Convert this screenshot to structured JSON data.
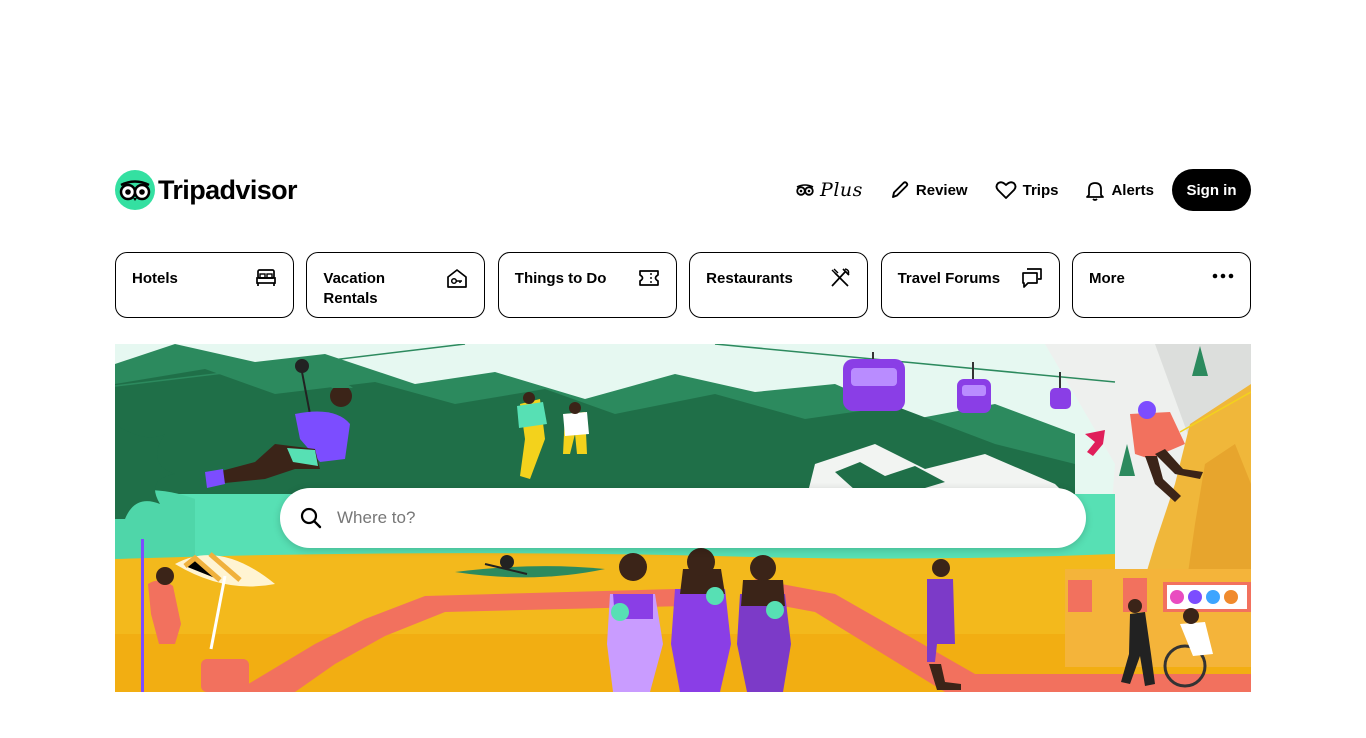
{
  "brand": {
    "name": "Tripadvisor",
    "logo_color": "#34e0a1"
  },
  "header": {
    "plus_label": "Plus",
    "review_label": "Review",
    "trips_label": "Trips",
    "alerts_label": "Alerts",
    "signin_label": "Sign in"
  },
  "categories": [
    {
      "label": "Hotels",
      "icon": "bed-icon"
    },
    {
      "label": "Vacation Rentals",
      "icon": "house-key-icon"
    },
    {
      "label": "Things to Do",
      "icon": "ticket-icon"
    },
    {
      "label": "Restaurants",
      "icon": "fork-knife-icon"
    },
    {
      "label": "Travel Forums",
      "icon": "chat-bubbles-icon"
    },
    {
      "label": "More",
      "icon": "more-dots-icon"
    }
  ],
  "search": {
    "placeholder": "Where to?",
    "value": ""
  },
  "colors": {
    "text": "#000000",
    "accent": "#34e0a1",
    "background": "#ffffff",
    "signin_bg": "#000000"
  }
}
